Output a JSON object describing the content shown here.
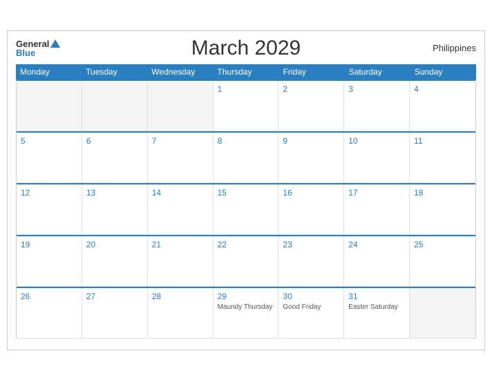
{
  "header": {
    "title": "March 2029",
    "country": "Philippines",
    "logo_general": "General",
    "logo_blue": "Blue"
  },
  "day_headers": [
    "Monday",
    "Tuesday",
    "Wednesday",
    "Thursday",
    "Friday",
    "Saturday",
    "Sunday"
  ],
  "weeks": [
    [
      {
        "number": "",
        "event": "",
        "empty": true
      },
      {
        "number": "",
        "event": "",
        "empty": true
      },
      {
        "number": "",
        "event": "",
        "empty": true
      },
      {
        "number": "1",
        "event": ""
      },
      {
        "number": "2",
        "event": ""
      },
      {
        "number": "3",
        "event": ""
      },
      {
        "number": "4",
        "event": ""
      }
    ],
    [
      {
        "number": "5",
        "event": ""
      },
      {
        "number": "6",
        "event": ""
      },
      {
        "number": "7",
        "event": ""
      },
      {
        "number": "8",
        "event": ""
      },
      {
        "number": "9",
        "event": ""
      },
      {
        "number": "10",
        "event": ""
      },
      {
        "number": "11",
        "event": ""
      }
    ],
    [
      {
        "number": "12",
        "event": ""
      },
      {
        "number": "13",
        "event": ""
      },
      {
        "number": "14",
        "event": ""
      },
      {
        "number": "15",
        "event": ""
      },
      {
        "number": "16",
        "event": ""
      },
      {
        "number": "17",
        "event": ""
      },
      {
        "number": "18",
        "event": ""
      }
    ],
    [
      {
        "number": "19",
        "event": ""
      },
      {
        "number": "20",
        "event": ""
      },
      {
        "number": "21",
        "event": ""
      },
      {
        "number": "22",
        "event": ""
      },
      {
        "number": "23",
        "event": ""
      },
      {
        "number": "24",
        "event": ""
      },
      {
        "number": "25",
        "event": ""
      }
    ],
    [
      {
        "number": "26",
        "event": ""
      },
      {
        "number": "27",
        "event": ""
      },
      {
        "number": "28",
        "event": ""
      },
      {
        "number": "29",
        "event": "Maundy Thursday"
      },
      {
        "number": "30",
        "event": "Good Friday"
      },
      {
        "number": "31",
        "event": "Easter Saturday"
      },
      {
        "number": "",
        "event": "",
        "empty": true
      }
    ]
  ]
}
